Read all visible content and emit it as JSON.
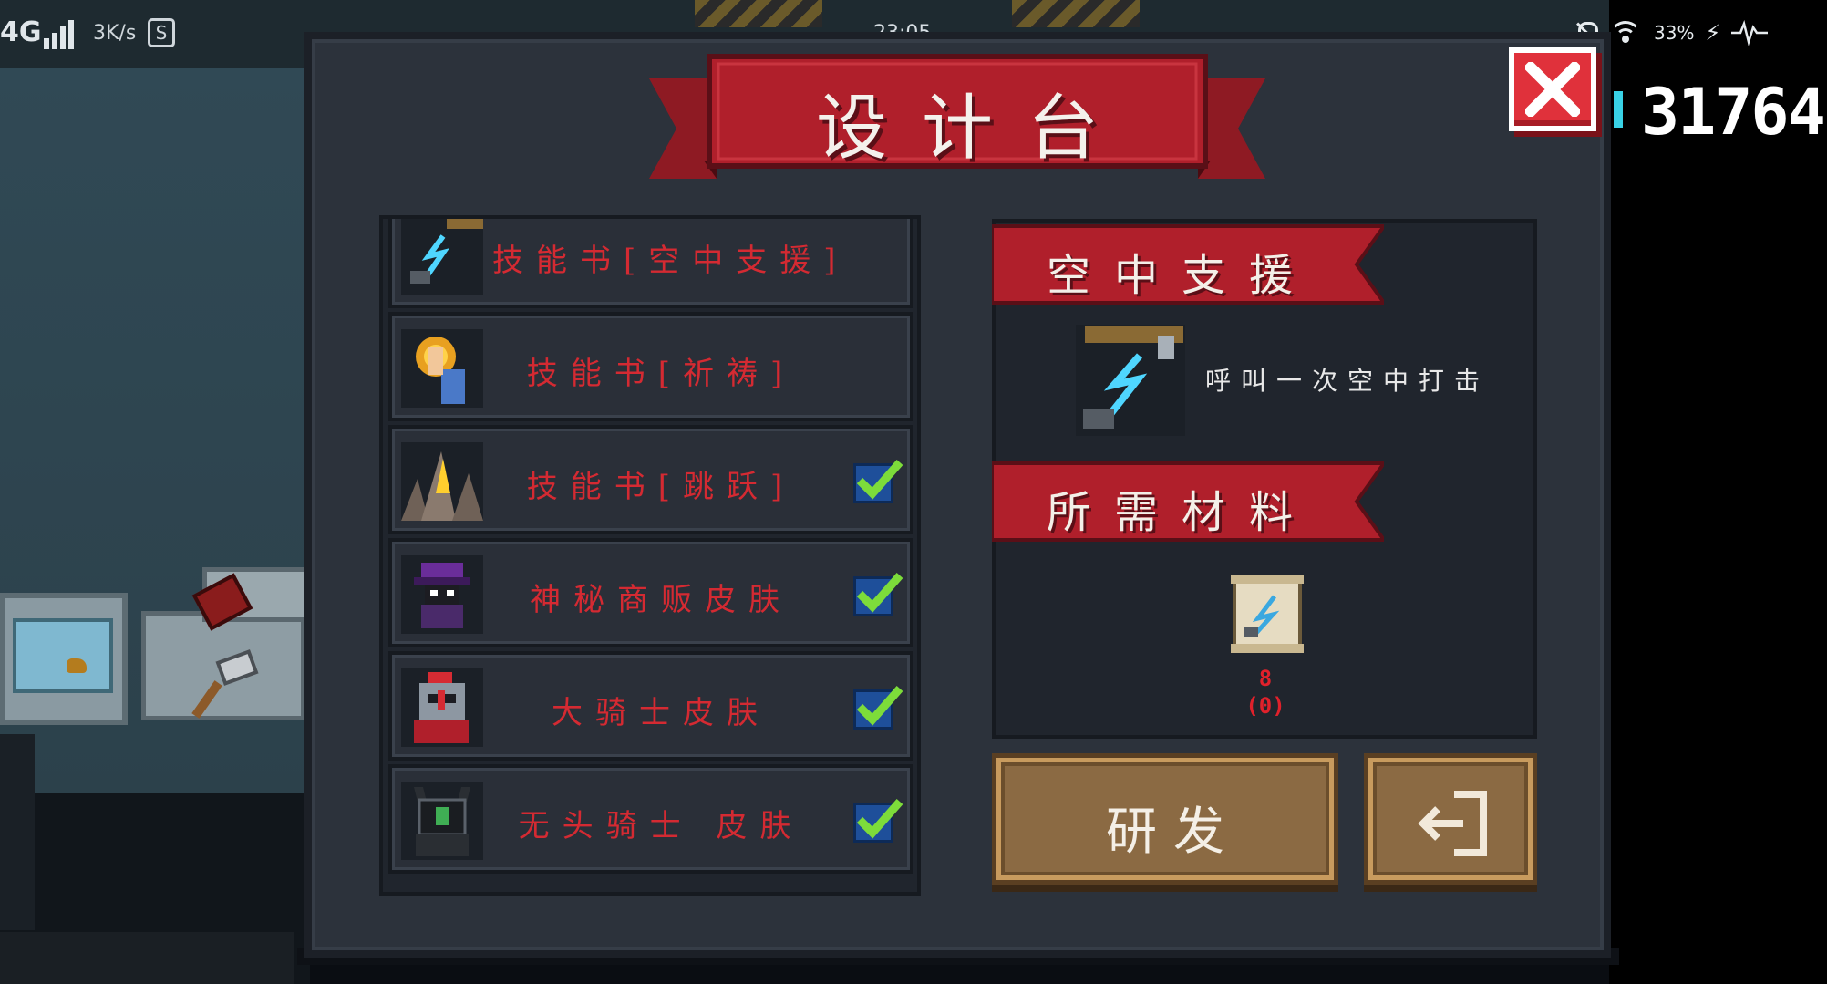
{
  "status_bar": {
    "network": "4G",
    "speed": "3K/s",
    "app_badge": "S",
    "time": "23:05",
    "battery": "33%"
  },
  "title": "设计台",
  "currency": {
    "count": "31764",
    "icon": "gem-icon"
  },
  "list": {
    "items": [
      {
        "label": "技能书[空中支援]",
        "icon": "lightning-tower-icon",
        "unlocked": false
      },
      {
        "label": "技能书[祈祷]",
        "icon": "praying-hand-icon",
        "unlocked": false
      },
      {
        "label": "技能书[跳跃]",
        "icon": "jump-spike-icon",
        "unlocked": true
      },
      {
        "label": "神秘商贩皮肤",
        "icon": "merchant-skin-icon",
        "unlocked": true
      },
      {
        "label": "大骑士皮肤",
        "icon": "grand-knight-skin-icon",
        "unlocked": true
      },
      {
        "label": "无头骑士 皮肤",
        "icon": "headless-knight-skin-icon",
        "unlocked": true
      }
    ]
  },
  "detail": {
    "name": "空中支援",
    "description": "呼叫一次空中打击",
    "materials_header": "所需材料",
    "material": {
      "icon": "blueprint-scroll-icon",
      "required": "8",
      "owned": "(0)"
    }
  },
  "buttons": {
    "research": "研发",
    "exit_icon": "exit-icon",
    "close_icon": "close-icon"
  },
  "colors": {
    "accent_red": "#b01f2b",
    "label_red": "#d42a32",
    "button_brown": "#8b6a43",
    "check_blue": "#1e4f9a",
    "check_green": "#7ddc3a"
  }
}
